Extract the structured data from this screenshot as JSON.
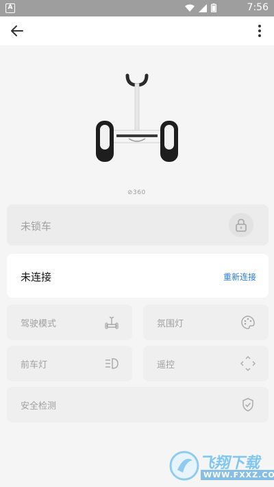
{
  "status_bar": {
    "app_badge": "A",
    "time": "7:56",
    "icons": [
      "wifi-icon",
      "signal-icon",
      "battery-icon"
    ]
  },
  "app_bar": {
    "back_icon": "back-arrow-icon",
    "menu_icon": "more-vert-icon"
  },
  "device": {
    "brand": "⊘360"
  },
  "lock": {
    "label": "未锁车",
    "icon": "lock-icon"
  },
  "connection": {
    "label": "未连接",
    "action": "重新连接",
    "action_color": "#2a7de1"
  },
  "features": [
    {
      "label": "驾驶模式",
      "icon": "scooter-icon"
    },
    {
      "label": "氛围灯",
      "icon": "palette-icon"
    },
    {
      "label": "前车灯",
      "icon": "headlight-icon"
    },
    {
      "label": "遥控",
      "icon": "remote-control-icon"
    }
  ],
  "safety": {
    "label": "安全检测",
    "icon": "shield-check-icon"
  },
  "watermark": {
    "main": "飞翔下载",
    "sub": "WWW.FXXZ.COM"
  }
}
